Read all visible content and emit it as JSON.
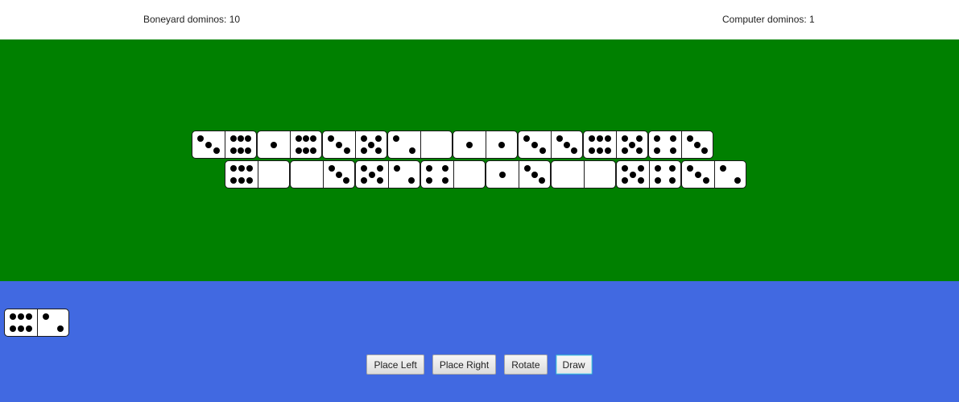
{
  "header": {
    "boneyard_text": "Boneyard dominos: 10",
    "computer_text": "Computer dominos: 1"
  },
  "colors": {
    "board": "#008000",
    "player_area": "#4169e1",
    "header": "#ffffff"
  },
  "board": {
    "row1": [
      [
        3,
        6
      ],
      [
        1,
        6
      ],
      [
        3,
        5
      ],
      [
        2,
        0
      ],
      [
        1,
        1
      ],
      [
        3,
        3
      ],
      [
        6,
        5
      ],
      [
        4,
        3
      ]
    ],
    "row2": [
      [
        6,
        0
      ],
      [
        0,
        3
      ],
      [
        5,
        2
      ],
      [
        4,
        0
      ],
      [
        1,
        3
      ],
      [
        0,
        0
      ],
      [
        5,
        4
      ],
      [
        3,
        2
      ]
    ]
  },
  "hand": [
    [
      6,
      2
    ]
  ],
  "controls": {
    "place_left": "Place Left",
    "place_right": "Place Right",
    "rotate": "Rotate",
    "draw": "Draw"
  }
}
